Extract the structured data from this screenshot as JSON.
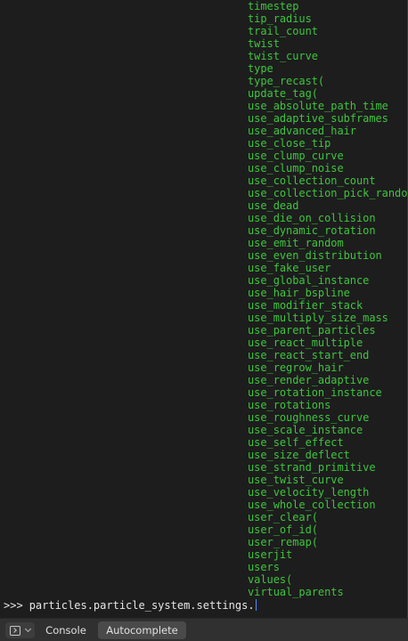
{
  "completions": [
    "timestep",
    "tip_radius",
    "trail_count",
    "twist",
    "twist_curve",
    "type",
    "type_recast(",
    "update_tag(",
    "use_absolute_path_time",
    "use_adaptive_subframes",
    "use_advanced_hair",
    "use_close_tip",
    "use_clump_curve",
    "use_clump_noise",
    "use_collection_count",
    "use_collection_pick_random",
    "use_dead",
    "use_die_on_collision",
    "use_dynamic_rotation",
    "use_emit_random",
    "use_even_distribution",
    "use_fake_user",
    "use_global_instance",
    "use_hair_bspline",
    "use_modifier_stack",
    "use_multiply_size_mass",
    "use_parent_particles",
    "use_react_multiple",
    "use_react_start_end",
    "use_regrow_hair",
    "use_render_adaptive",
    "use_rotation_instance",
    "use_rotations",
    "use_roughness_curve",
    "use_scale_instance",
    "use_self_effect",
    "use_size_deflect",
    "use_strand_primitive",
    "use_twist_curve",
    "use_velocity_length",
    "use_whole_collection",
    "user_clear(",
    "user_of_id(",
    "user_remap(",
    "userjit",
    "users",
    "values(",
    "virtual_parents"
  ],
  "prompt": {
    "symbol": ">>>",
    "input": "particles.particle_system.settings."
  },
  "footer": {
    "editor_type_icon": "console-icon",
    "menu_console": "Console",
    "menu_autocomplete": "Autocomplete"
  },
  "colors": {
    "background": "#1d1d1d",
    "completion_text": "#3ec53e",
    "prompt_text": "#e6e6e6",
    "cursor": "#4f8cff",
    "footer_background": "#303030"
  }
}
